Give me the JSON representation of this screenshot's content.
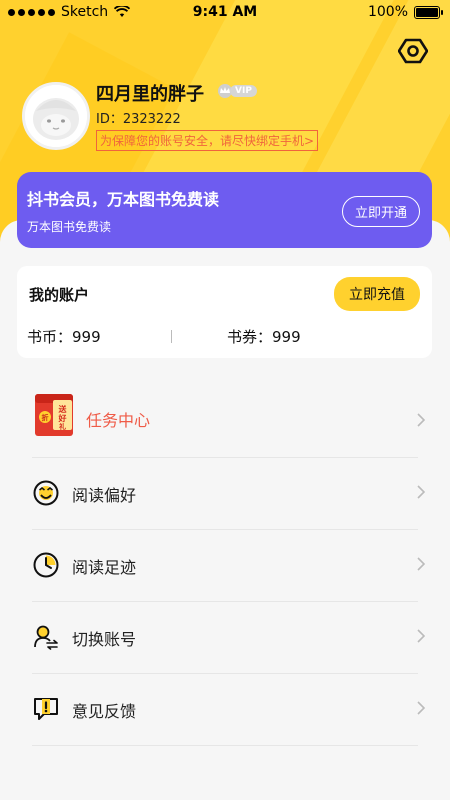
{
  "status_bar": {
    "carrier": "Sketch",
    "time": "9:41 AM",
    "battery": "100%"
  },
  "profile": {
    "username": "四月里的胖子",
    "vip_badge": "VIP",
    "id_text": "ID：2323222",
    "security_warning": "为保障您的账号安全，请尽快绑定手机>"
  },
  "vip_card": {
    "title": "抖书会员，万本图书免费读",
    "subtitle": "万本图书免费读",
    "button_label": "立即开通"
  },
  "account": {
    "label": "我的账户",
    "recharge_label": "立即充值",
    "coins": "书币：999",
    "tickets": "书券：999"
  },
  "menu": [
    {
      "label": "任务中心",
      "icon": "gift-envelope-icon"
    },
    {
      "label": "阅读偏好",
      "icon": "smiley-icon"
    },
    {
      "label": "阅读足迹",
      "icon": "clock-icon"
    },
    {
      "label": "切换账号",
      "icon": "switch-user-icon"
    },
    {
      "label": "意见反馈",
      "icon": "feedback-icon"
    }
  ],
  "colors": {
    "accent_yellow": "#ffd12e",
    "vip_purple": "#6e5cf0",
    "task_red": "#ef5b47"
  }
}
